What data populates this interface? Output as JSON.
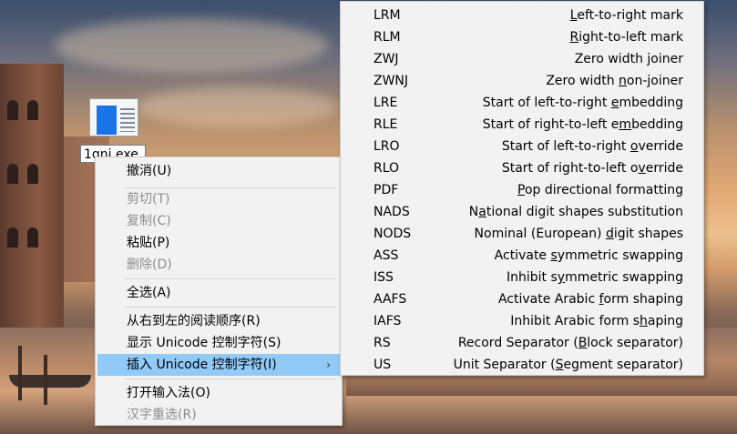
{
  "desktop": {
    "rename_value": "1qnj.exe"
  },
  "context_menu": {
    "items": [
      {
        "label": "撤消(U)",
        "underline_index": 3,
        "enabled": true
      },
      {
        "label": "剪切(T)",
        "enabled": false
      },
      {
        "label": "复制(C)",
        "enabled": false
      },
      {
        "label": "粘贴(P)",
        "enabled": true
      },
      {
        "label": "删除(D)",
        "enabled": false
      },
      {
        "label": "全选(A)",
        "enabled": true
      },
      {
        "label": "从右到左的阅读顺序(R)",
        "enabled": true
      },
      {
        "label": "显示 Unicode 控制字符(S)",
        "enabled": true
      },
      {
        "label": "插入 Unicode 控制字符(I)",
        "enabled": true,
        "highlighted": true,
        "submenu_arrow": "›"
      },
      {
        "label": "打开输入法(O)",
        "enabled": true
      },
      {
        "label": "汉字重选(R)",
        "enabled": false
      }
    ]
  },
  "unicode_submenu": {
    "items": [
      {
        "code": "LRM",
        "pre": "",
        "key": "L",
        "post": "eft-to-right mark"
      },
      {
        "code": "RLM",
        "pre": "",
        "key": "R",
        "post": "ight-to-left mark"
      },
      {
        "code": "ZWJ",
        "pre": "Zero width ",
        "key": "j",
        "post": "oiner"
      },
      {
        "code": "ZWNJ",
        "pre": "Zero width ",
        "key": "n",
        "post": "on-joiner"
      },
      {
        "code": "LRE",
        "pre": "Start of left-to-right ",
        "key": "e",
        "post": "mbedding"
      },
      {
        "code": "RLE",
        "pre": "Start of right-to-left e",
        "key": "m",
        "post": "bedding"
      },
      {
        "code": "LRO",
        "pre": "Start of left-to-right ",
        "key": "o",
        "post": "verride"
      },
      {
        "code": "RLO",
        "pre": "Start of right-to-left o",
        "key": "v",
        "post": "erride"
      },
      {
        "code": "PDF",
        "pre": "",
        "key": "P",
        "post": "op directional formatting"
      },
      {
        "code": "NADS",
        "pre": "N",
        "key": "a",
        "post": "tional digit shapes substitution"
      },
      {
        "code": "NODS",
        "pre": "Nominal (European) ",
        "key": "d",
        "post": "igit shapes"
      },
      {
        "code": "ASS",
        "pre": "Activate ",
        "key": "s",
        "post": "ymmetric swapping"
      },
      {
        "code": "ISS",
        "pre": "Inhibit s",
        "key": "y",
        "post": "mmetric swapping"
      },
      {
        "code": "AAFS",
        "pre": "Activate Arabic ",
        "key": "f",
        "post": "orm shaping"
      },
      {
        "code": "IAFS",
        "pre": "Inhibit Arabic form s",
        "key": "h",
        "post": "aping"
      },
      {
        "code": "RS",
        "pre": "Record Separator (",
        "key": "B",
        "post": "lock separator)"
      },
      {
        "code": "US",
        "pre": "Unit Separator (",
        "key": "S",
        "post": "egment separator)"
      }
    ]
  },
  "colors": {
    "menu_bg": "#f2f2f2",
    "highlight": "#91c9f7",
    "disabled_text": "#8d8d8d"
  }
}
